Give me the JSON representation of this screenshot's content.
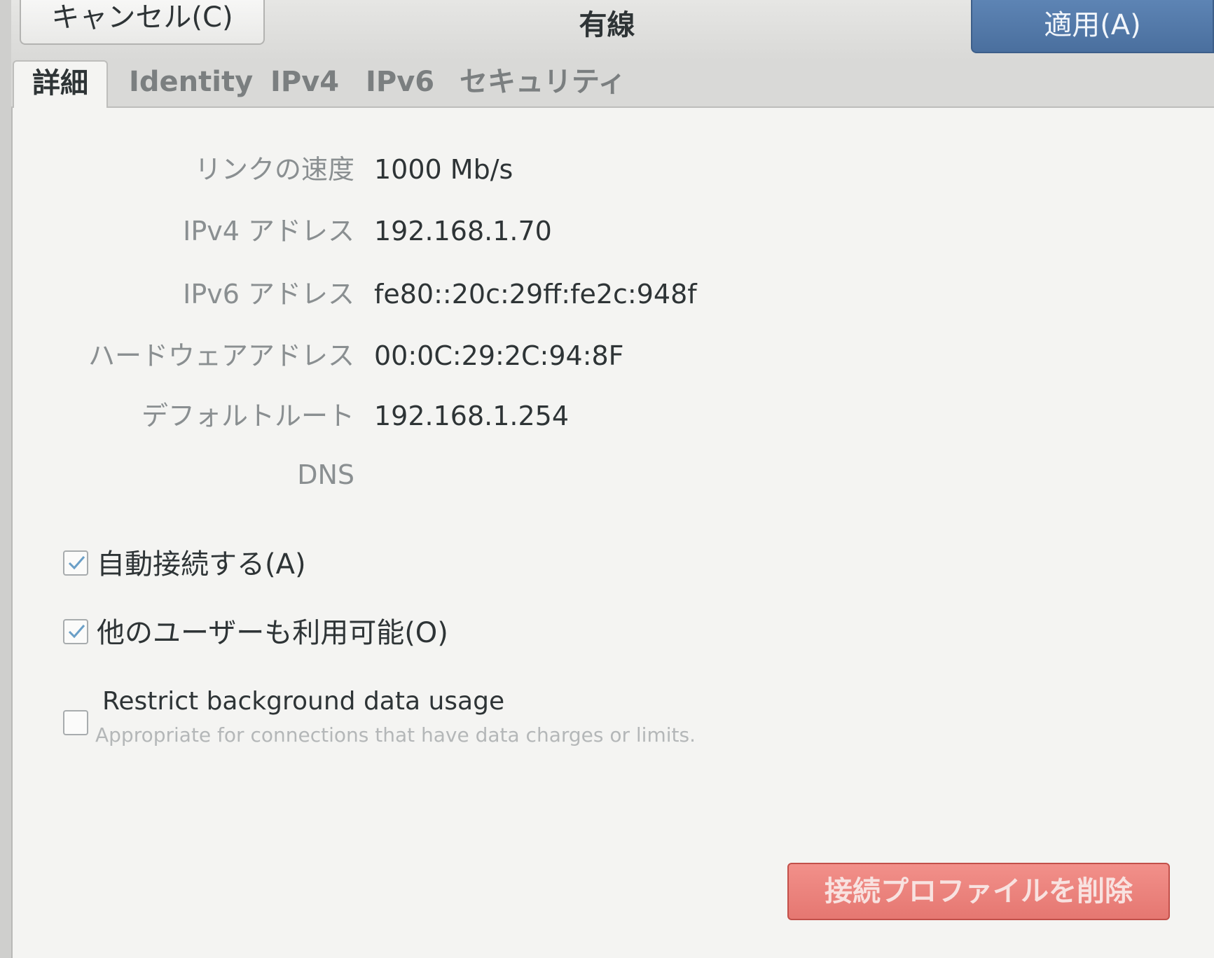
{
  "header": {
    "cancel_label": "キャンセル(C)",
    "title": "有線",
    "apply_label": "適用(A)"
  },
  "tabs": [
    {
      "label": "詳細",
      "active": true
    },
    {
      "label": "Identity",
      "active": false
    },
    {
      "label": "IPv4",
      "active": false
    },
    {
      "label": "IPv6",
      "active": false
    },
    {
      "label": "セキュリティ",
      "active": false
    }
  ],
  "details": {
    "link_speed": {
      "label": "リンクの速度",
      "value": "1000 Mb/s"
    },
    "ipv4_address": {
      "label": "IPv4 アドレス",
      "value": "192.168.1.70"
    },
    "ipv6_address": {
      "label": "IPv6 アドレス",
      "value": "fe80::20c:29ff:fe2c:948f"
    },
    "hardware_address": {
      "label": "ハードウェアアドレス",
      "value": "00:0C:29:2C:94:8F"
    },
    "default_route": {
      "label": "デフォルトルート",
      "value": "192.168.1.254"
    },
    "dns": {
      "label": "DNS",
      "value": ""
    }
  },
  "options": {
    "auto_connect": {
      "label": "自動接続する(A)",
      "checked": true
    },
    "other_users": {
      "label": "他のユーザーも利用可能(O)",
      "checked": true
    },
    "restrict_background": {
      "label": "Restrict background data usage",
      "description": "Appropriate for connections that have data charges or limits.",
      "checked": false
    }
  },
  "footer": {
    "delete_label": "接続プロファイルを削除"
  },
  "colors": {
    "apply_button": "#4a6f9e",
    "delete_button": "#e57771"
  }
}
